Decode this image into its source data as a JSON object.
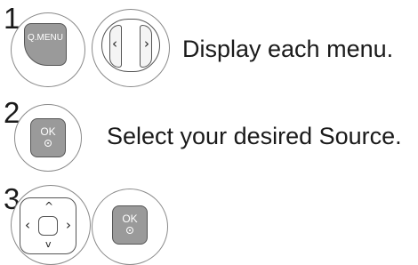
{
  "steps": [
    {
      "number": "1",
      "buttons": [
        {
          "label": "Q.MENU",
          "icon": "qmenu-button-icon"
        },
        {
          "label": "< >",
          "icon": "left-right-arrow-button-icon"
        }
      ],
      "text": "Display each menu."
    },
    {
      "number": "2",
      "buttons": [
        {
          "label": "OK",
          "icon": "ok-button-icon"
        }
      ],
      "text": "Select your desired Source."
    },
    {
      "number": "3",
      "buttons": [
        {
          "label": "",
          "icon": "dpad-navigation-icon"
        },
        {
          "label": "OK",
          "icon": "ok-button-icon"
        }
      ],
      "text": ""
    }
  ],
  "glyphs": {
    "left": "‹",
    "right": "›",
    "up": "^",
    "down": "v"
  },
  "colors": {
    "button_fill": "#9a9a9a",
    "ring_outline": "#8a8a8a",
    "text": "#1a1a1a"
  }
}
